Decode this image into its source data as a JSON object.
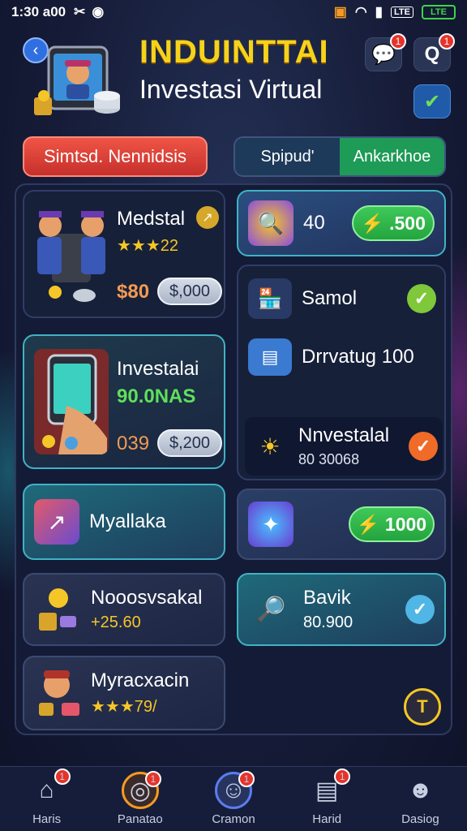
{
  "status_bar": {
    "time": "1:30 a00",
    "network": "LTE",
    "battery": "LTE"
  },
  "header": {
    "title": "INDUINTTAI",
    "subtitle": "Investasi Virtual",
    "back_icon": "chevron-left-icon",
    "chat_badge": "1",
    "profile_badge": "1"
  },
  "buttons": {
    "primary": "Simtsd. Nennidsis"
  },
  "segments": [
    {
      "label": "Spipud'"
    },
    {
      "label": "Ankarkhoe"
    }
  ],
  "left_cards": [
    {
      "title": "Medstal",
      "rating": "★★★22",
      "price": "$80",
      "action": "$,000"
    },
    {
      "title": "Investalai",
      "subtitle": "90.0NAS",
      "price": "039",
      "action": "$,200"
    },
    {
      "title": "Myallaka"
    },
    {
      "title": "Nooosvsakal",
      "value": "+25.60"
    },
    {
      "title": "Myracxacin",
      "rating": "★★★79/"
    }
  ],
  "right_cards": [
    {
      "value": "40",
      "action": "⚡ .500"
    },
    {
      "title": "Samol",
      "state": "check"
    },
    {
      "title": "Drrvatug 100"
    },
    {
      "title": "Nnvestalal",
      "value": "80 30068",
      "state": "check"
    },
    {
      "action": "⚡ 1000"
    },
    {
      "title": "Bavik",
      "value": "80.900",
      "state": "check"
    }
  ],
  "nav": [
    {
      "label": "Haris",
      "badge": "1"
    },
    {
      "label": "Panatao",
      "badge": "1"
    },
    {
      "label": "Cramon",
      "badge": "1"
    },
    {
      "label": "Harid",
      "badge": "1"
    },
    {
      "label": "Dasiog"
    }
  ],
  "colors": {
    "accent": "#f6d21a",
    "green": "#3fc95a",
    "red": "#e5342b"
  }
}
